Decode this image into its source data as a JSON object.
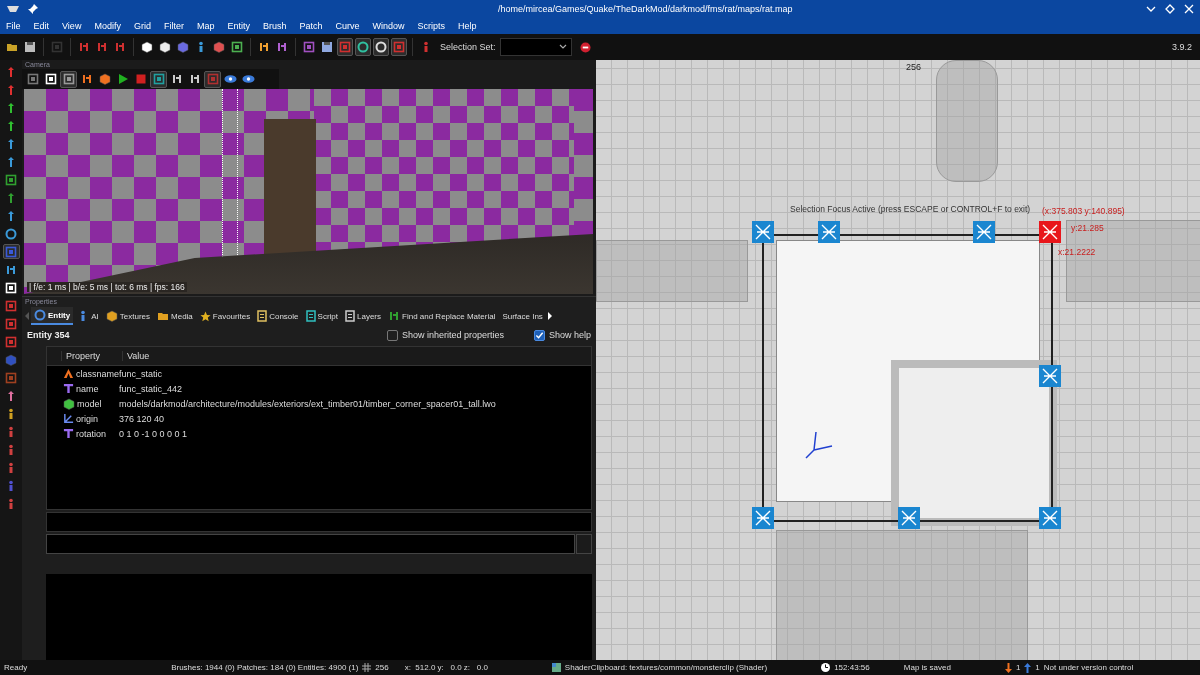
{
  "window": {
    "title": "/home/mircea/Games/Quake/TheDarkMod/darkmod/fms/rat/maps/rat.map"
  },
  "menu": [
    "File",
    "Edit",
    "View",
    "Modify",
    "Grid",
    "Filter",
    "Map",
    "Entity",
    "Brush",
    "Patch",
    "Curve",
    "Window",
    "Scripts",
    "Help"
  ],
  "toolbar": {
    "buttons": [
      {
        "pressed": false
      },
      {
        "pressed": false
      },
      {
        "pressed": false
      },
      {
        "pressed": false
      },
      {
        "pressed": false
      },
      {
        "pressed": false
      },
      {
        "pressed": false
      },
      {
        "pressed": false
      },
      {
        "pressed": false
      },
      {
        "pressed": false
      },
      {
        "pressed": false
      },
      {
        "pressed": false
      },
      {
        "pressed": false
      },
      {
        "pressed": false
      },
      {
        "pressed": false
      },
      {
        "pressed": false
      },
      {
        "pressed": true
      },
      {
        "pressed": true
      },
      {
        "pressed": true
      },
      {
        "pressed": true
      },
      {
        "pressed": false
      }
    ],
    "selection_set_label": "Selection Set:",
    "version": "3.9.2"
  },
  "left_toolbar": [
    {
      "pressed": false
    },
    {
      "pressed": false
    },
    {
      "pressed": false
    },
    {
      "pressed": false
    },
    {
      "pressed": false
    },
    {
      "pressed": false
    },
    {
      "pressed": false
    },
    {
      "pressed": false
    },
    {
      "pressed": false
    },
    {
      "pressed": false
    },
    {
      "pressed": true
    },
    {
      "pressed": false
    },
    {
      "pressed": false
    },
    {
      "pressed": false
    },
    {
      "pressed": false
    },
    {
      "pressed": false
    },
    {
      "pressed": false
    },
    {
      "pressed": false
    },
    {
      "pressed": false
    },
    {
      "pressed": false
    },
    {
      "pressed": false
    },
    {
      "pressed": false
    },
    {
      "pressed": false
    },
    {
      "pressed": false
    },
    {
      "pressed": false
    }
  ],
  "camera": {
    "title": "Camera",
    "buttons": [
      {
        "pressed": false
      },
      {
        "pressed": false
      },
      {
        "pressed": true
      },
      {
        "pressed": false
      },
      {
        "pressed": false
      },
      {
        "pressed": false
      },
      {
        "pressed": false
      },
      {
        "pressed": true
      },
      {
        "pressed": false
      },
      {
        "pressed": false
      },
      {
        "pressed": true
      },
      {
        "pressed": false
      },
      {
        "pressed": false
      }
    ],
    "stats": "| f/e: 1 ms | b/e: 5 ms | tot: 6 ms | fps: 166"
  },
  "properties": {
    "title": "Properties",
    "tabs": [
      {
        "label": "Entity",
        "selected": true
      },
      {
        "label": "AI",
        "selected": false
      },
      {
        "label": "Textures",
        "selected": false
      },
      {
        "label": "Media",
        "selected": false
      },
      {
        "label": "Favourites",
        "selected": false
      },
      {
        "label": "Console",
        "selected": false
      },
      {
        "label": "Script",
        "selected": false
      },
      {
        "label": "Layers",
        "selected": false
      },
      {
        "label": "Find and Replace Material",
        "selected": false
      },
      {
        "label": "Surface Ins",
        "selected": false
      }
    ],
    "entity": "Entity 354",
    "show_inherited": {
      "label": "Show inherited properties",
      "checked": false
    },
    "show_help": {
      "label": "Show help",
      "checked": true
    },
    "columns": [
      "Property",
      "Value"
    ],
    "rows": [
      {
        "kind": "class",
        "key": "classname",
        "value": "func_static"
      },
      {
        "kind": "text",
        "key": "name",
        "value": "func_static_442"
      },
      {
        "kind": "model",
        "key": "model",
        "value": "models/darkmod/architecture/modules/exteriors/ext_timber01/timber_corner_spacer01_tall.lwo"
      },
      {
        "kind": "vector",
        "key": "origin",
        "value": "376 120 40"
      },
      {
        "kind": "text",
        "key": "rotation",
        "value": "0 1 0 -1 0 0 0 0 1"
      }
    ]
  },
  "ortho_view": {
    "ruler": "256",
    "focus_message": "Selection Focus Active (press ESCAPE or CONTROL+F to exit)",
    "cursor_coords": "(x:375.803  y:140.895)",
    "height_reading": "y:21.285",
    "width_reading": "x:21.2222",
    "handles": [
      {
        "active": false
      },
      {
        "active": false
      },
      {
        "active": false
      },
      {
        "active": true
      },
      {
        "active": false
      },
      {
        "active": false
      },
      {
        "active": false
      },
      {
        "active": false
      }
    ]
  },
  "status_bar": {
    "status": "Ready",
    "counts": "Brushes: 1944 (0) Patches: 184 (0) Entities: 4900 (1)",
    "grid": "256",
    "position": "x:  512.0 y:   0.0 z:   0.0",
    "shader": "ShaderClipboard: textures/common/monsterclip (Shader)",
    "time": "152:43:56",
    "map_state": "Map is saved",
    "changes_down": "1",
    "changes_up": "1",
    "vcs": "Not under version control"
  }
}
